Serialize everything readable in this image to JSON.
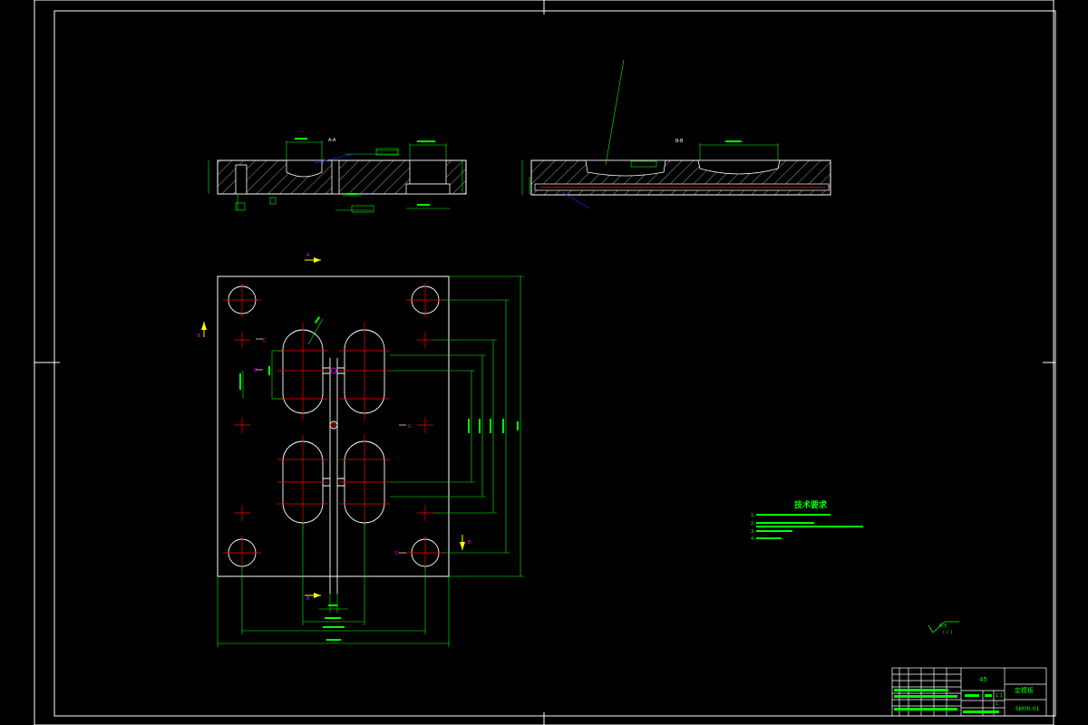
{
  "colors": {
    "background": "#000000",
    "outline": "#ffffff",
    "dimension": "#00ff00",
    "centerline": "#ff0000",
    "leader": "#0033ff",
    "marker": "#ffff00",
    "marker_tag": "#ff00ff",
    "notes": "#00ff00"
  },
  "section_views": {
    "left_label": "A-A",
    "right_label": "B-B"
  },
  "view_markers": [
    "A",
    "A",
    "B",
    "B",
    "C",
    "C",
    "D",
    "D"
  ],
  "technical_requirements": {
    "title": "技术要求",
    "lines": [
      "1.",
      "2.",
      "3.",
      "4."
    ]
  },
  "surface_finish": {
    "value": "6.3",
    "suffix": "( √ )"
  },
  "title_block": {
    "material": "45",
    "part_name": "定模板",
    "drawing_no": "SM00-01",
    "scale": "1:1",
    "sheet": "1"
  }
}
